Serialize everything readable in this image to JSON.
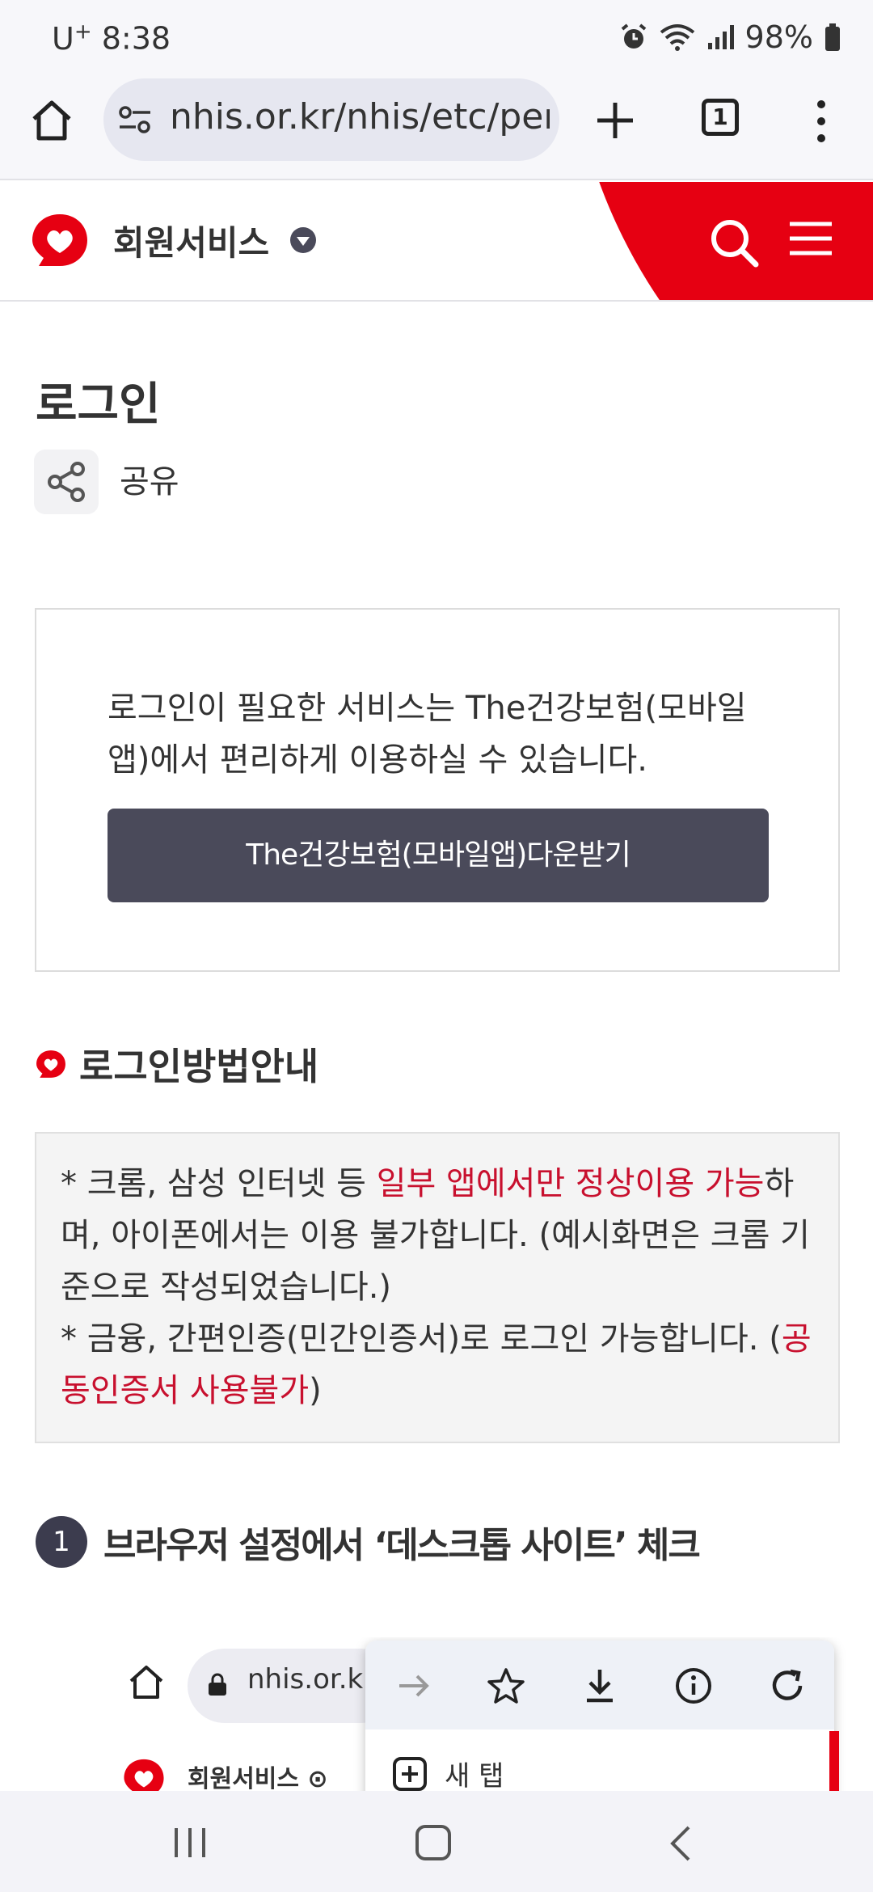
{
  "status_bar": {
    "carrier": "U",
    "carrier_sup": "+",
    "time": "8:38",
    "battery": "98%",
    "icons": [
      "alarm-icon",
      "wifi-icon",
      "signal-icon",
      "battery-icon"
    ]
  },
  "browser": {
    "url": "nhis.or.kr/nhis/etc/per",
    "tab_count": "1",
    "icons": [
      "home-icon",
      "site-info-icon",
      "new-tab-plus-icon",
      "tabs-icon",
      "more-menu-icon"
    ]
  },
  "header": {
    "title": "회원서비스",
    "brand_color": "#e60012",
    "icons": [
      "nhis-logo-icon",
      "chevron-down-icon",
      "search-icon",
      "hamburger-menu-icon"
    ]
  },
  "page": {
    "title": "로그인",
    "share_label": "공유"
  },
  "notice": {
    "text": "로그인이 필요한 서비스는 The건강보험(모바일앱)에서 편리하게 이용하실 수 있습니다.",
    "button_label": "The건강보험(모바일앱)다운받기",
    "button_color": "#4a4a5a"
  },
  "section": {
    "title": "로그인방법안내"
  },
  "info": {
    "line1_pre": "* 크롬, 삼성 인터넷 등 ",
    "line1_red": "일부 앱에서만 정상이용 가능",
    "line1_post": "하며, 아이폰에서는 이용 불가합니다. (예시화면은 크롬 기준으로 작성되었습니다.)",
    "line2_pre": "* 금융, 간편인증(민간인증서)로 로그인 가능합니다. (",
    "line2_red": "공동인증서 사용불가",
    "line2_post": ")",
    "highlight_color": "#c8102e"
  },
  "step1": {
    "number": "1",
    "text": "브라우저 설정에서 ‘데스크톱 사이트’ 체크"
  },
  "example": {
    "url_text": "nhis.or.k",
    "site_title": "회원서비스",
    "new_tab_label": "새 탭",
    "menu_icons": [
      "forward-arrow-icon",
      "star-icon",
      "download-icon",
      "info-icon",
      "refresh-icon"
    ]
  },
  "nav_bar": {
    "icons": [
      "recents-icon",
      "home-nav-icon",
      "back-icon"
    ]
  }
}
